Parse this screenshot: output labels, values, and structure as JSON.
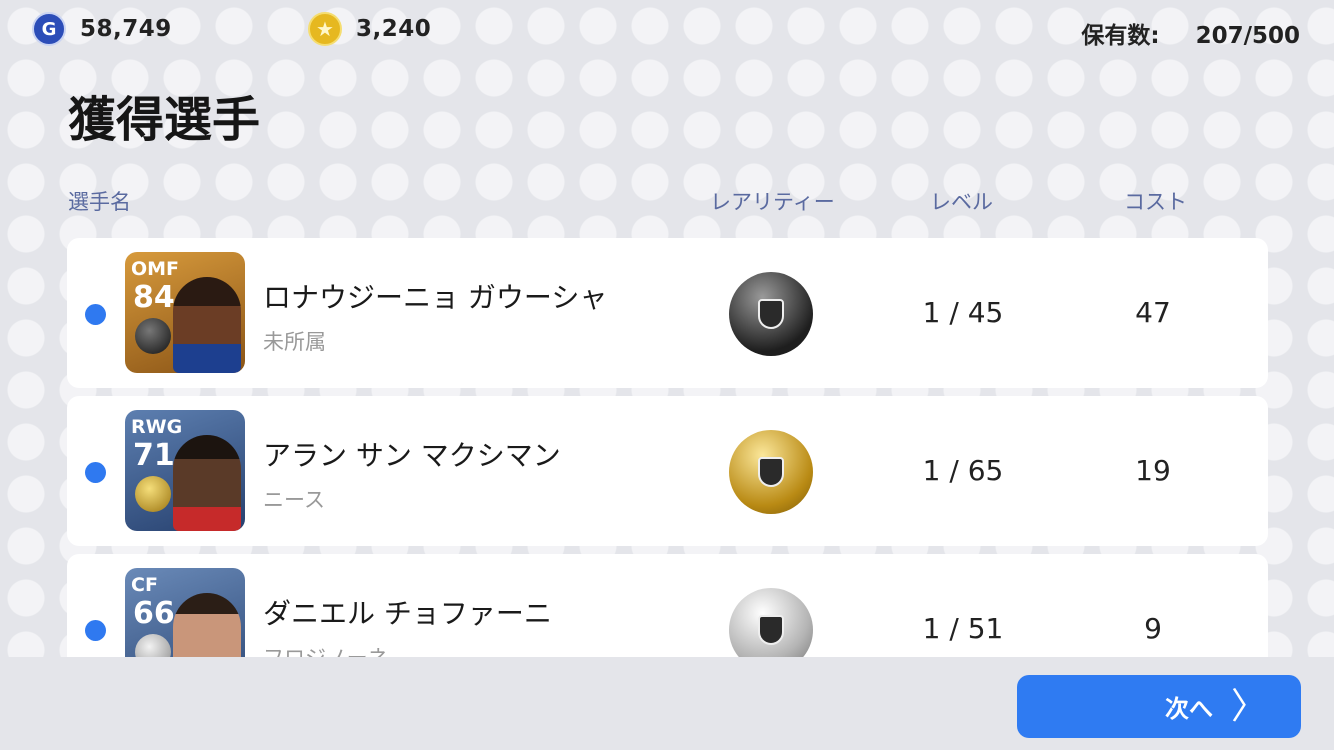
{
  "header": {
    "gp": {
      "icon": "g-coin-icon",
      "glyph": "G",
      "value": "58,749"
    },
    "coins": {
      "icon": "star-coin-icon",
      "glyph": "★",
      "value": "3,240"
    },
    "owned_label": "保有数:",
    "owned_value": "207/500"
  },
  "title": "獲得選手",
  "columns": {
    "name": "選手名",
    "rarity": "レアリティー",
    "level": "レベル",
    "cost": "コスト"
  },
  "players": [
    {
      "position": "OMF",
      "rating": "84",
      "name": "ロナウジーニョ ガウーシャ",
      "club": "未所属",
      "level": "1 / 45",
      "cost": "47",
      "rarity": "black-ball-icon"
    },
    {
      "position": "RWG",
      "rating": "71",
      "name": "アラン サン マクシマン",
      "club": "ニース",
      "level": "1 / 65",
      "cost": "19",
      "rarity": "gold-ball-icon"
    },
    {
      "position": "CF",
      "rating": "66",
      "name": "ダニエル チョファーニ",
      "club": "フロジノーネ",
      "level": "1 / 51",
      "cost": "9",
      "rarity": "silver-ball-icon"
    }
  ],
  "next_button": {
    "label": "次へ",
    "icon": "chevron-right-icon",
    "glyph": "〉"
  },
  "colors": {
    "accent": "#2f7bf2",
    "dot": "#2f79f0"
  }
}
